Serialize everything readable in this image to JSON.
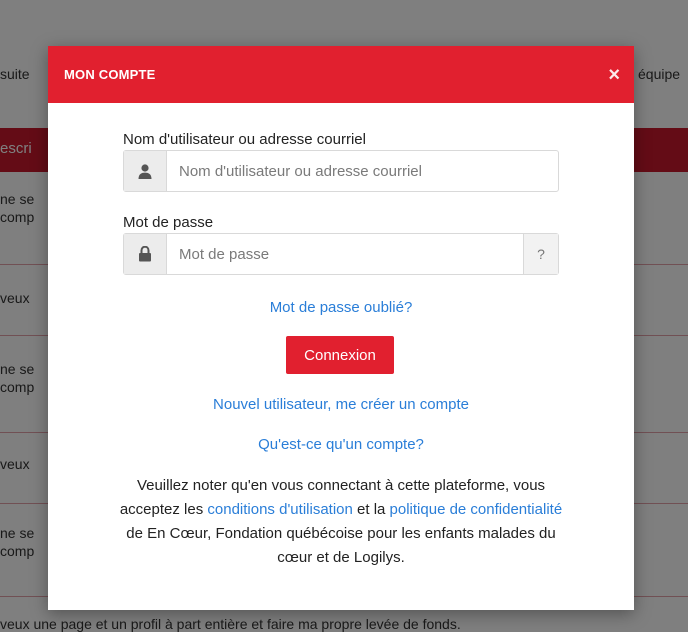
{
  "background": {
    "top_left_text": "suite",
    "top_right_text": "équipe",
    "header_text": "escri",
    "rows": [
      {
        "line1": "ne se",
        "line2": "comp"
      },
      {
        "line1": "veux",
        "line2": ""
      },
      {
        "line1": "ne se",
        "line2": "comp"
      },
      {
        "line1": "veux",
        "line2": ""
      },
      {
        "line1": "ne se",
        "line2": "comp"
      }
    ],
    "bottom_text": "veux une page et un profil à part entière et faire ma propre levée de fonds."
  },
  "modal": {
    "title": "MON COMPTE",
    "close_symbol": "×",
    "username": {
      "label": "Nom d'utilisateur ou adresse courriel",
      "placeholder": "Nom d'utilisateur ou adresse courriel",
      "icon": "user-icon"
    },
    "password": {
      "label": "Mot de passe",
      "placeholder": "Mot de passe",
      "icon": "lock-icon",
      "help": "?"
    },
    "forgot_link": "Mot de passe oublié?",
    "login_button": "Connexion",
    "new_user_link": "Nouvel utilisateur, me créer un compte",
    "what_is_account_link": "Qu'est-ce qu'un compte?",
    "notice": {
      "part1": "Veuillez noter qu'en vous connectant à cette plateforme, vous acceptez les ",
      "terms_link": "conditions d'utilisation",
      "part2": " et la ",
      "privacy_link": "politique de confidentialité",
      "part3": " de En Cœur, Fondation québécoise pour les enfants malades du cœur et de Logilys."
    }
  }
}
